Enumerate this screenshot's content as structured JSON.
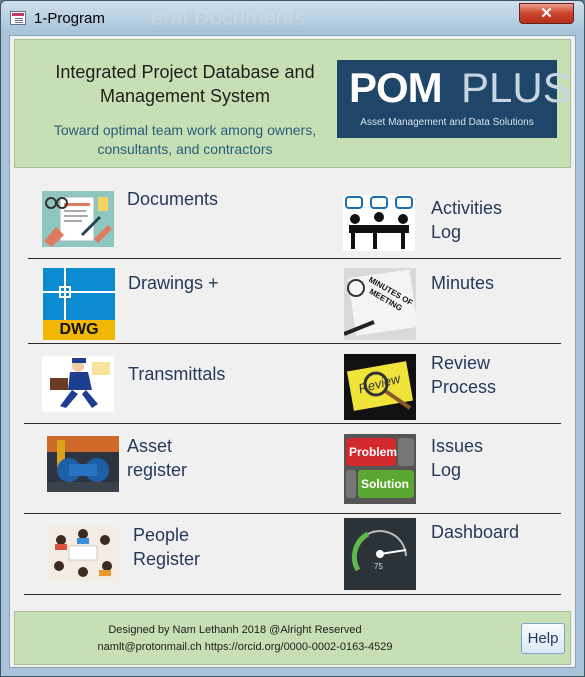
{
  "window": {
    "title": "1-Program",
    "background_ghost_text": "eral Documents",
    "close_label": "✕"
  },
  "header": {
    "title": "Integrated Project Database and Management System",
    "subtitle": "Toward optimal team work among owners, consultants, and contractors",
    "logo": {
      "pom": "POM",
      "plus": "PLUS",
      "tagline": "Asset Management and Data Solutions",
      "bg_color": "#1f4668"
    }
  },
  "menu": {
    "documents": {
      "label": "Documents",
      "icon": "documents-icon"
    },
    "activities_log": {
      "label": "Activities\nLog",
      "icon": "activities-icon"
    },
    "drawings": {
      "label": "Drawings +",
      "icon": "dwg-icon",
      "icon_text": "DWG"
    },
    "minutes": {
      "label": "Minutes",
      "icon": "minutes-icon",
      "icon_text": "MINUTES OF MEETING"
    },
    "transmittals": {
      "label": "Transmittals",
      "icon": "courier-icon"
    },
    "review_process": {
      "label": "Review\nProcess",
      "icon": "review-icon",
      "icon_text": "Review"
    },
    "asset_register": {
      "label": "Asset\nregister",
      "icon": "pump-icon"
    },
    "issues_log": {
      "label": "Issues\nLog",
      "icon": "problem-solution-icon",
      "icon_text_1": "Problem",
      "icon_text_2": "Solution"
    },
    "people_register": {
      "label": "People\nRegister",
      "icon": "people-icon"
    },
    "dashboard": {
      "label": "Dashboard",
      "icon": "gauge-icon",
      "icon_text": "75"
    }
  },
  "footer": {
    "line1": "Designed by Nam Lethanh 2018 @Alright Reserved",
    "line2": "namlt@protonmail.ch   https://orcid.org/0000-0002-0163-4529",
    "help_label": "Help"
  },
  "colors": {
    "panel_green": "#c6dfb4",
    "label_blue": "#27395a",
    "subtitle_blue": "#2a5d7a"
  }
}
